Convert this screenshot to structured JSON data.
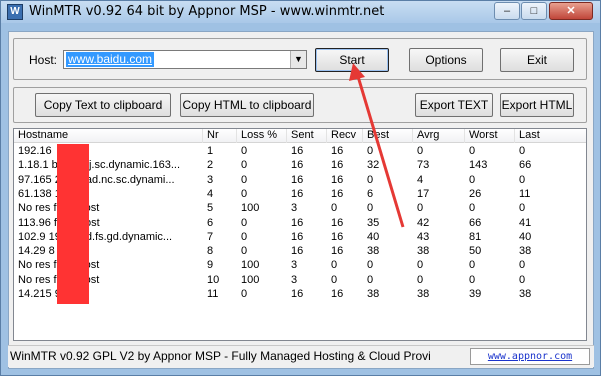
{
  "window": {
    "title": "WinMTR v0.92 64 bit by Appnor MSP - www.winmtr.net",
    "min_glyph": "–",
    "max_glyph": "□",
    "close_glyph": "✕"
  },
  "host": {
    "label": "Host:",
    "value": "www.baidu.com"
  },
  "buttons": {
    "start": "Start",
    "options": "Options",
    "exit": "Exit",
    "copy_text": "Copy Text to clipboard",
    "copy_html": "Copy HTML to clipboard",
    "export_text": "Export TEXT",
    "export_html": "Export HTML"
  },
  "table": {
    "columns": [
      "Hostname",
      "Nr",
      "Loss %",
      "Sent",
      "Recv",
      "Best",
      "Avrg",
      "Worst",
      "Last"
    ],
    "rows": [
      [
        "192.16",
        "1",
        "0",
        "16",
        "16",
        "0",
        "0",
        "0",
        "0"
      ],
      [
        "1.18.1  broad.nj.sc.dynamic.163...",
        "2",
        "0",
        "16",
        "16",
        "32",
        "73",
        "143",
        "66"
      ],
      [
        "97.165  22.broad.nc.sc.dynami...",
        "3",
        "0",
        "16",
        "16",
        "0",
        "4",
        "0",
        "0"
      ],
      [
        "61.138  1",
        "4",
        "0",
        "16",
        "16",
        "6",
        "17",
        "26",
        "11"
      ],
      [
        "No res  from host",
        "5",
        "100",
        "3",
        "0",
        "0",
        "0",
        "0",
        "0"
      ],
      [
        "113.96  from host",
        "6",
        "0",
        "16",
        "16",
        "35",
        "42",
        "66",
        "41"
      ],
      [
        "102.9   19.broad.fs.gd.dynamic...",
        "7",
        "0",
        "16",
        "16",
        "40",
        "43",
        "81",
        "40"
      ],
      [
        "14.29   8",
        "8",
        "0",
        "16",
        "16",
        "38",
        "38",
        "50",
        "38"
      ],
      [
        "No res  from host",
        "9",
        "100",
        "3",
        "0",
        "0",
        "0",
        "0",
        "0"
      ],
      [
        "No res  from host",
        "10",
        "100",
        "3",
        "0",
        "0",
        "0",
        "0",
        "0"
      ],
      [
        "14.215  9",
        "11",
        "0",
        "16",
        "16",
        "38",
        "38",
        "39",
        "38"
      ]
    ]
  },
  "status": {
    "text": "WinMTR v0.92 GPL V2 by Appnor MSP - Fully Managed Hosting & Cloud Provi",
    "link": "www.appnor.com"
  },
  "colors": {
    "redaction": "#ff3333",
    "annotation_arrow": "#e53935",
    "selection": "#3399ff"
  }
}
